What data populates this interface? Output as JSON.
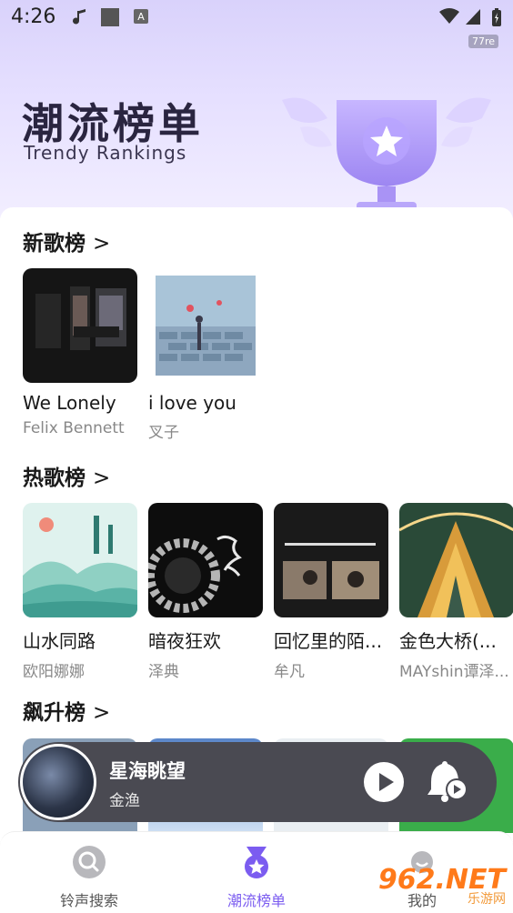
{
  "status": {
    "time": "4:26",
    "speed": "77re"
  },
  "hero": {
    "title": "潮流榜单",
    "subtitle": "Trendy Rankings"
  },
  "sections": [
    {
      "title": "新歌榜",
      "chevron": ">",
      "items": [
        {
          "song": "We Lonely",
          "artist": "Felix Bennett"
        },
        {
          "song": "i love you",
          "artist": "叉子"
        }
      ]
    },
    {
      "title": "热歌榜",
      "chevron": ">",
      "items": [
        {
          "song": "山水同路",
          "artist": "欧阳娜娜"
        },
        {
          "song": "暗夜狂欢",
          "artist": "泽典"
        },
        {
          "song": "回忆里的陌...",
          "artist": "牟凡"
        },
        {
          "song": "金色大桥(...",
          "artist": "MAYshin谭泽..."
        }
      ]
    },
    {
      "title": "飙升榜",
      "chevron": ">"
    }
  ],
  "player": {
    "title": "星海眺望",
    "artist": "金渔"
  },
  "nav": [
    {
      "label": "铃声搜索",
      "active": false
    },
    {
      "label": "潮流榜单",
      "active": true
    },
    {
      "label": "我的",
      "active": false
    }
  ],
  "colors": {
    "accent": "#7b5cf0",
    "player_bg": "#4a4a52",
    "hero_bg": "#e6e0ff"
  },
  "watermark": {
    "brand": "962.NET",
    "sub": "乐游网"
  }
}
